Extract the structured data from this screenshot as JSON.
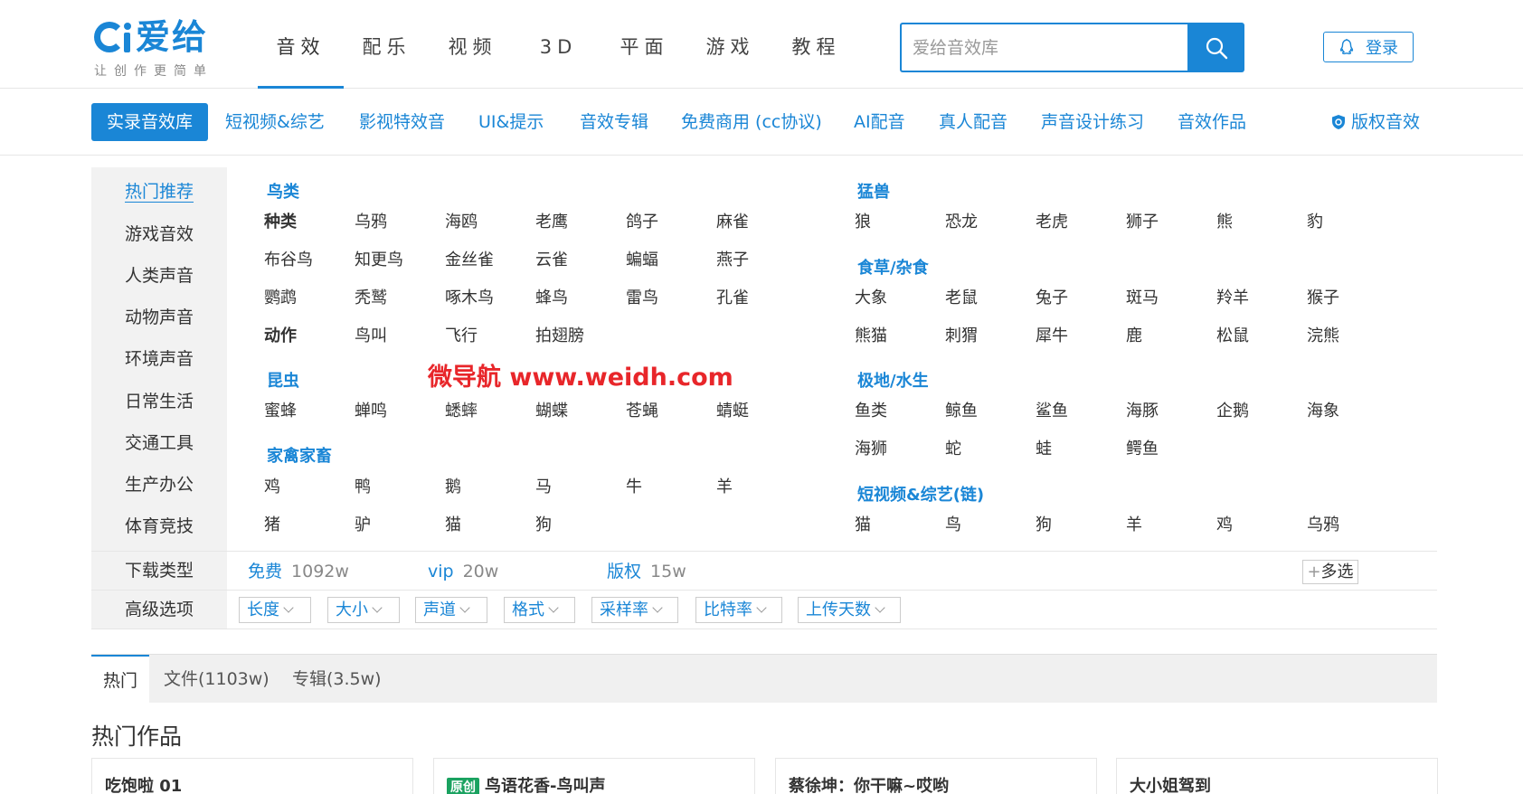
{
  "logo": {
    "text": "爱给",
    "slogan": "让创作更简单"
  },
  "nav": [
    "音效",
    "配乐",
    "视频",
    "3D",
    "平面",
    "游戏",
    "教程"
  ],
  "search": {
    "placeholder": "爱给音效库"
  },
  "login": {
    "label": "登录"
  },
  "categories": [
    "实录音效库",
    "短视频&综艺",
    "影视特效音",
    "UI&提示",
    "音效专辑",
    "免费商用 (cc协议)",
    "AI配音",
    "真人配音",
    "声音设计练习",
    "音效作品"
  ],
  "copyright_link": "版权音效",
  "sidebar": [
    "热门推荐",
    "游戏音效",
    "人类声音",
    "动物声音",
    "环境声音",
    "日常生活",
    "交通工具",
    "生产办公",
    "体育竞技"
  ],
  "left": {
    "birds": {
      "title": "鸟类",
      "species_label": "种类",
      "species": [
        "乌鸦",
        "海鸥",
        "老鹰",
        "鸽子",
        "麻雀",
        "布谷鸟",
        "知更鸟",
        "金丝雀",
        "云雀",
        "蝙蝠",
        "燕子",
        "鹦鹉",
        "秃鹫",
        "啄木鸟",
        "蜂鸟",
        "雷鸟",
        "孔雀"
      ],
      "action_label": "动作",
      "actions": [
        "鸟叫",
        "飞行",
        "拍翅膀"
      ]
    },
    "insects": {
      "title": "昆虫",
      "items": [
        "蜜蜂",
        "蝉鸣",
        "蟋蟀",
        "蝴蝶",
        "苍蝇",
        "蜻蜓"
      ]
    },
    "livestock": {
      "title": "家禽家畜",
      "items": [
        "鸡",
        "鸭",
        "鹅",
        "马",
        "牛",
        "羊",
        "猪",
        "驴",
        "猫",
        "狗"
      ]
    }
  },
  "right": {
    "beasts": {
      "title": "猛兽",
      "items": [
        "狼",
        "恐龙",
        "老虎",
        "狮子",
        "熊",
        "豹"
      ]
    },
    "herbivores": {
      "title": "食草/杂食",
      "items": [
        "大象",
        "老鼠",
        "兔子",
        "斑马",
        "羚羊",
        "猴子",
        "熊猫",
        "刺猬",
        "犀牛",
        "鹿",
        "松鼠",
        "浣熊"
      ]
    },
    "aquatic": {
      "title": "极地/水生",
      "items": [
        "鱼类",
        "鲸鱼",
        "鲨鱼",
        "海豚",
        "企鹅",
        "海象",
        "海狮",
        "蛇",
        "蛙",
        "鳄鱼"
      ]
    },
    "shortvideo": {
      "title": "短视频&综艺(链)",
      "items": [
        "猫",
        "鸟",
        "狗",
        "羊",
        "鸡",
        "乌鸦"
      ]
    }
  },
  "watermark": "微导航 www.weidh.com",
  "download": {
    "label": "下载类型",
    "options": [
      {
        "name": "免费",
        "count": "1092w"
      },
      {
        "name": "vip",
        "count": "20w"
      },
      {
        "name": "版权",
        "count": "15w"
      }
    ],
    "multi": "多选"
  },
  "advanced": {
    "label": "高级选项",
    "options": [
      "长度",
      "大小",
      "声道",
      "格式",
      "采样率",
      "比特率",
      "上传天数"
    ]
  },
  "tabs": [
    "热门",
    "文件(1103w)",
    "专辑(3.5w)"
  ],
  "hot_title": "热门作品",
  "cards": [
    {
      "badge": "",
      "title": "吃饱啦 01"
    },
    {
      "badge": "原创",
      "title": "鸟语花香-鸟叫声"
    },
    {
      "badge": "",
      "title": "蔡徐坤：你干嘛~哎哟"
    },
    {
      "badge": "",
      "title": "大小姐驾到"
    }
  ],
  "colors": {
    "accent": "#1a86d6",
    "watermark": "#e8262a",
    "badge": "#1aa260"
  }
}
